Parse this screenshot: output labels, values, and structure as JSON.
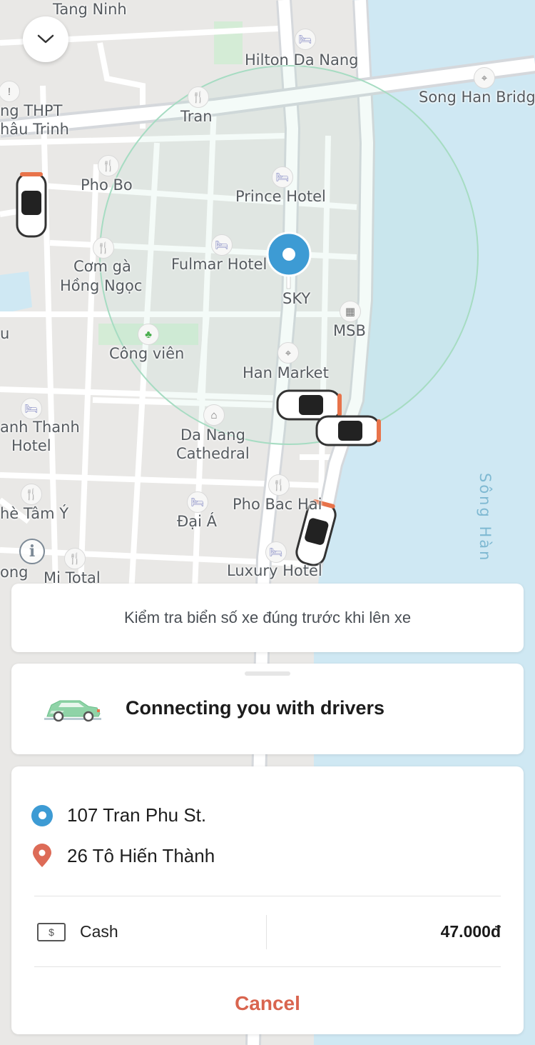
{
  "map": {
    "labels": [
      {
        "text": "Tang Ninh",
        "name": "map-label-tang-ninh"
      },
      {
        "text": "Hilton Da Nang",
        "name": "map-label-hilton"
      },
      {
        "text": "Song Han Bridg",
        "name": "map-label-song-han-bridge"
      },
      {
        "text": "ng THPT",
        "name": "map-label-thpt"
      },
      {
        "text": "hâu Trinh",
        "name": "map-label-chau-trinh"
      },
      {
        "text": "Tran",
        "name": "map-label-tran"
      },
      {
        "text": "Pho Bo",
        "name": "map-label-pho-bo"
      },
      {
        "text": "Prince Hotel",
        "name": "map-label-prince-hotel"
      },
      {
        "text": "Cơm gà",
        "name": "map-label-com-ga"
      },
      {
        "text": "Hồng Ngọc",
        "name": "map-label-hong-ngoc"
      },
      {
        "text": "Fulmar Hotel",
        "name": "map-label-fulmar-hotel"
      },
      {
        "text": "SKY",
        "name": "map-label-sky"
      },
      {
        "text": "MSB",
        "name": "map-label-msb"
      },
      {
        "text": "Công viên",
        "name": "map-label-cong-vien"
      },
      {
        "text": "Han Market",
        "name": "map-label-han-market"
      },
      {
        "text": "anh Thanh",
        "name": "map-label-anh-thanh"
      },
      {
        "text": "Hotel",
        "name": "map-label-anh-thanh-hotel"
      },
      {
        "text": "Da Nang",
        "name": "map-label-da-nang"
      },
      {
        "text": "Cathedral",
        "name": "map-label-cathedral"
      },
      {
        "text": "Pho Bac Hai",
        "name": "map-label-pho-bac-hai"
      },
      {
        "text": "hè Tâm Ý",
        "name": "map-label-tam-y"
      },
      {
        "text": "Đại Á",
        "name": "map-label-dai-a"
      },
      {
        "text": "ong",
        "name": "map-label-ong"
      },
      {
        "text": "Mi Total",
        "name": "map-label-mi-total"
      },
      {
        "text": "Luxury Hotel",
        "name": "map-label-luxury-hotel"
      },
      {
        "text": "u",
        "name": "map-label-u"
      }
    ],
    "river_label": "Sông Hàn",
    "colors": {
      "water": "#cfe8f3",
      "road": "#ffffff",
      "land": "#e9e8e6",
      "radius": "#a6dcc2",
      "pin": "#3d9bd4"
    }
  },
  "notice": {
    "text": "Kiểm tra biển số xe đúng trước khi lên xe"
  },
  "status": {
    "title": "Connecting you with drivers",
    "icon": "car-icon"
  },
  "trip": {
    "pickup": "107 Tran Phu St.",
    "dropoff": "26 Tô Hiến Thành",
    "payment_method": "Cash",
    "payment_icon_symbol": "$",
    "price": "47.000đ",
    "cancel_label": "Cancel"
  },
  "icons": {
    "collapse": "chevron-down-icon",
    "info": "info-icon"
  },
  "accent_color": "#d9654f"
}
